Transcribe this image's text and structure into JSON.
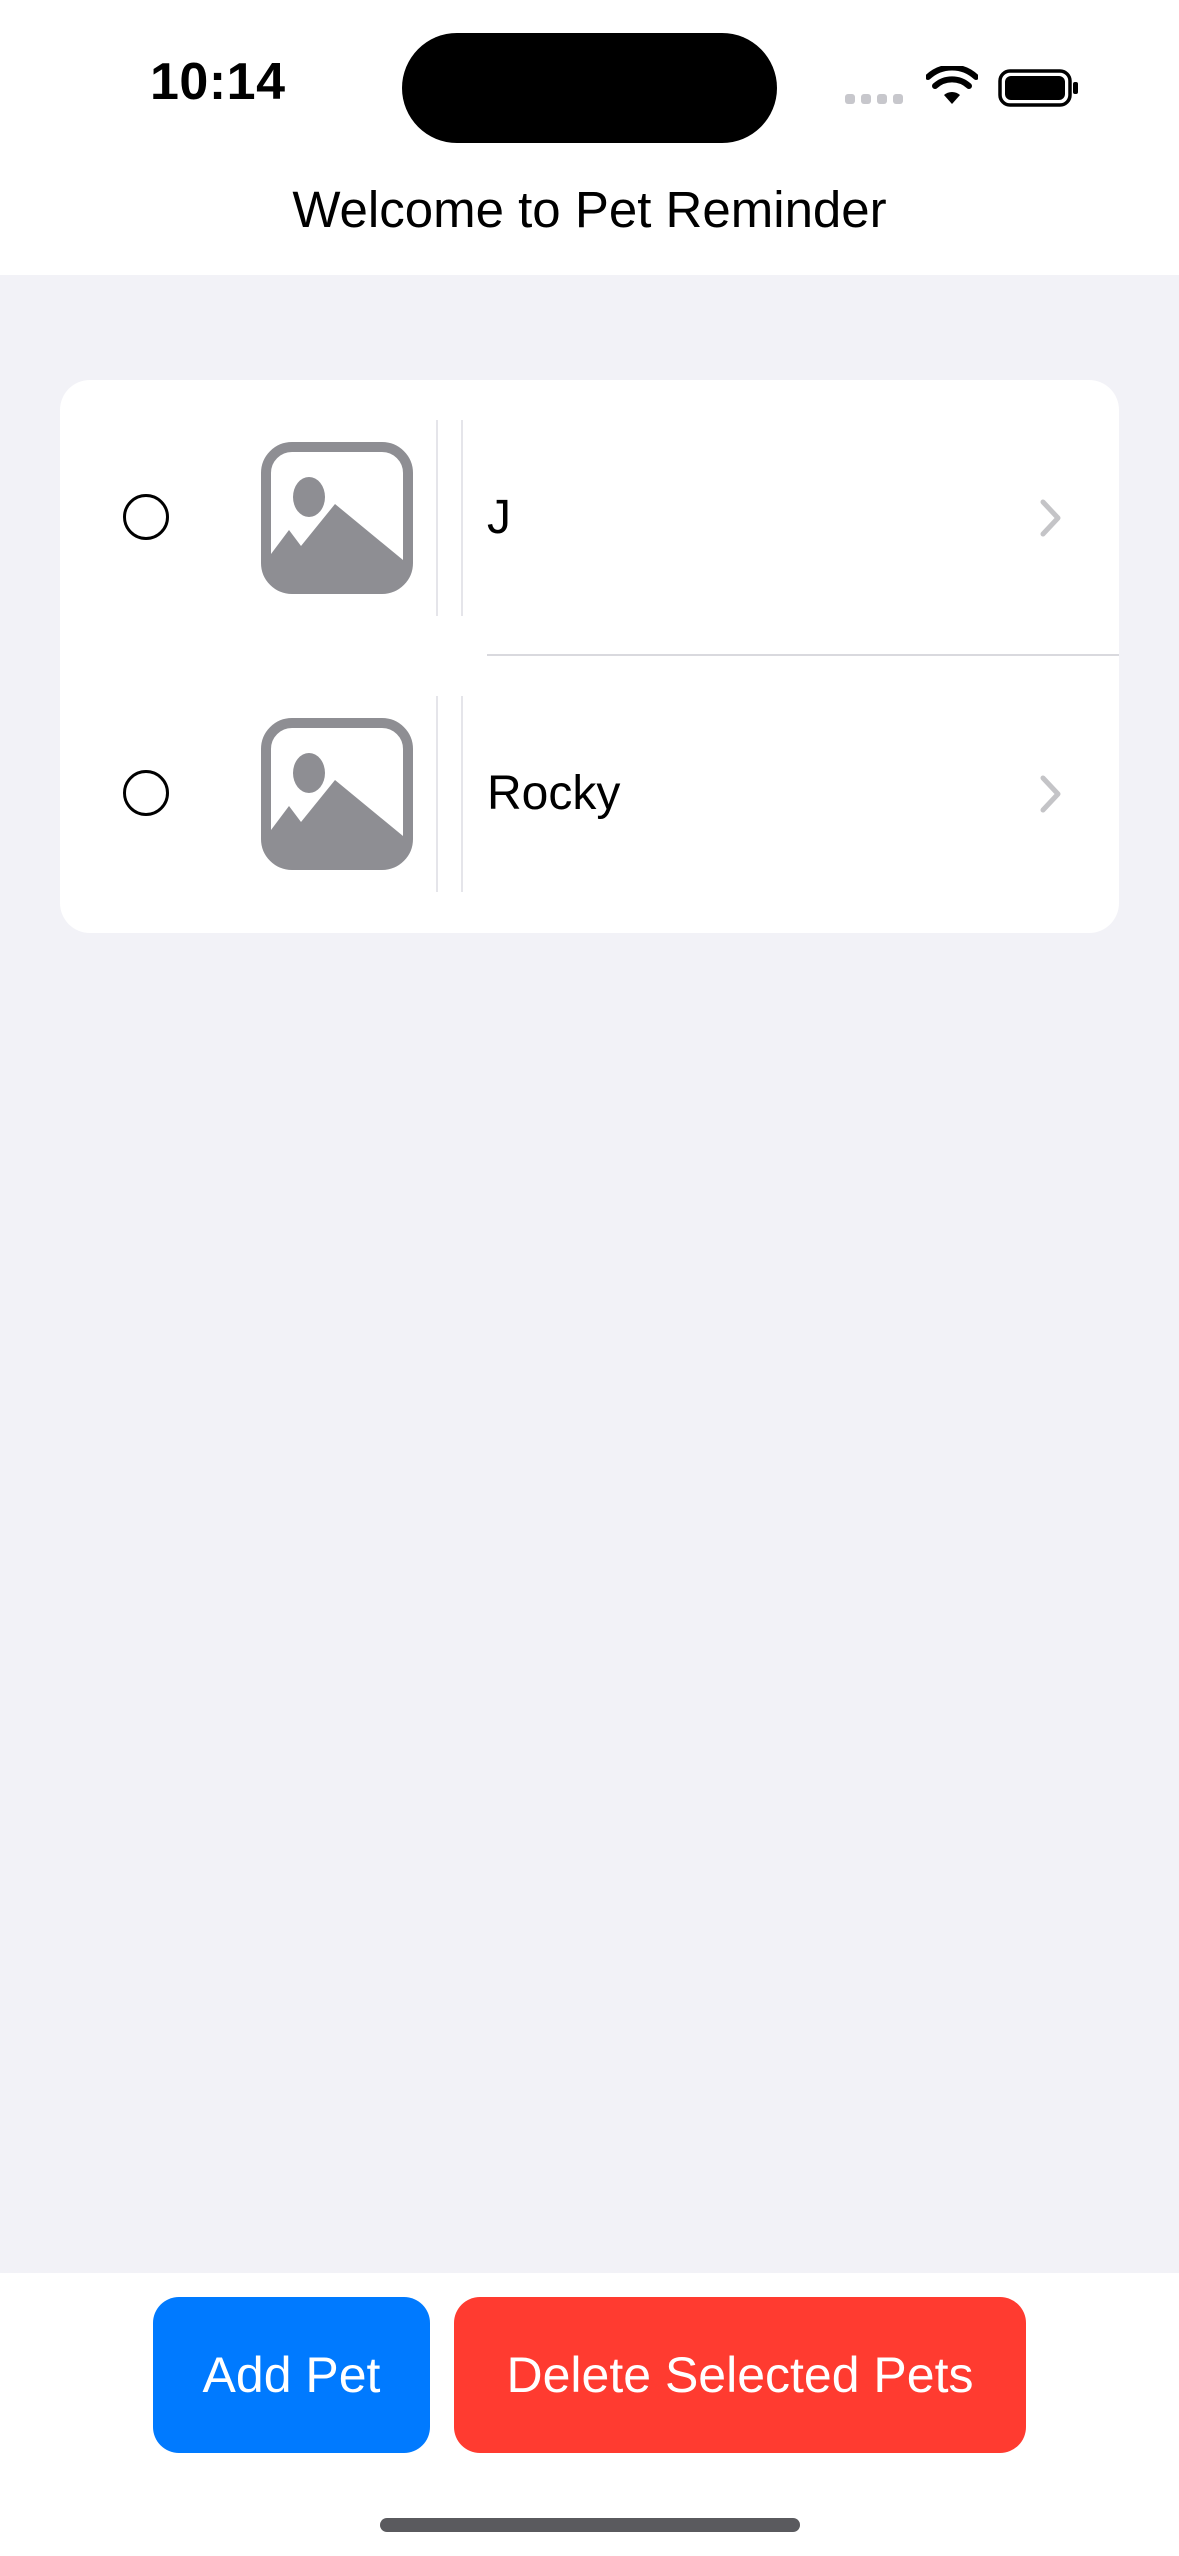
{
  "status_bar": {
    "time": "10:14"
  },
  "header": {
    "title": "Welcome to Pet Reminder"
  },
  "pets": [
    {
      "name": "J",
      "selected": false,
      "icon": "photo-placeholder-icon"
    },
    {
      "name": "Rocky",
      "selected": false,
      "icon": "photo-placeholder-icon"
    }
  ],
  "actions": {
    "add_label": "Add Pet",
    "delete_label": "Delete Selected Pets"
  },
  "colors": {
    "background": "#f2f2f7",
    "add_button": "#007aff",
    "delete_button": "#ff3b30",
    "placeholder_icon": "#8e8e93",
    "chevron": "#c4c4c7"
  }
}
